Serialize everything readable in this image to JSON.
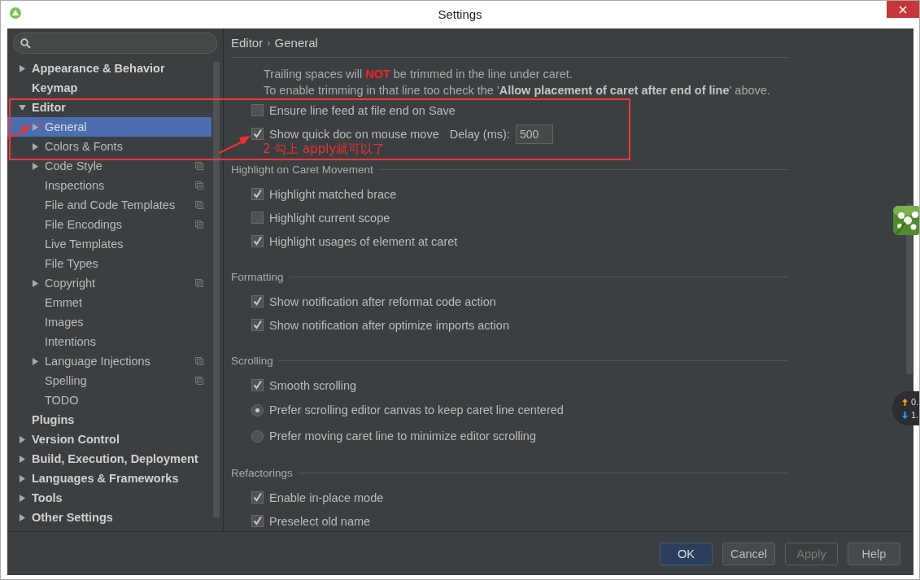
{
  "window": {
    "title": "Settings"
  },
  "sidebar": {
    "items": [
      {
        "label": "Appearance & Behavior",
        "expanded": false,
        "selected": false,
        "per_project": false
      },
      {
        "label": "Keymap",
        "selected": false,
        "per_project": false
      },
      {
        "label": "Editor",
        "expanded": true,
        "selected": false,
        "per_project": false,
        "children": [
          {
            "label": "General",
            "expanded": false,
            "selected": true,
            "per_project": false
          },
          {
            "label": "Colors & Fonts",
            "expanded": false,
            "selected": false,
            "per_project": false
          },
          {
            "label": "Code Style",
            "expanded": false,
            "selected": false,
            "per_project": true
          },
          {
            "label": "Inspections",
            "selected": false,
            "per_project": true
          },
          {
            "label": "File and Code Templates",
            "selected": false,
            "per_project": true
          },
          {
            "label": "File Encodings",
            "selected": false,
            "per_project": true
          },
          {
            "label": "Live Templates",
            "selected": false,
            "per_project": false
          },
          {
            "label": "File Types",
            "selected": false,
            "per_project": false
          },
          {
            "label": "Copyright",
            "expanded": false,
            "selected": false,
            "per_project": true
          },
          {
            "label": "Emmet",
            "selected": false,
            "per_project": false
          },
          {
            "label": "Images",
            "selected": false,
            "per_project": false
          },
          {
            "label": "Intentions",
            "selected": false,
            "per_project": false
          },
          {
            "label": "Language Injections",
            "expanded": false,
            "selected": false,
            "per_project": true
          },
          {
            "label": "Spelling",
            "selected": false,
            "per_project": true
          },
          {
            "label": "TODO",
            "selected": false,
            "per_project": false
          }
        ]
      },
      {
        "label": "Plugins",
        "selected": false,
        "per_project": false
      },
      {
        "label": "Version Control",
        "expanded": false,
        "selected": false,
        "per_project": false
      },
      {
        "label": "Build, Execution, Deployment",
        "expanded": false,
        "selected": false,
        "per_project": false
      },
      {
        "label": "Languages & Frameworks",
        "expanded": false,
        "selected": false,
        "per_project": false
      },
      {
        "label": "Tools",
        "expanded": false,
        "selected": false,
        "per_project": false
      },
      {
        "label": "Other Settings",
        "expanded": false,
        "selected": false,
        "per_project": false
      }
    ]
  },
  "breadcrumb": [
    "Editor",
    "›",
    "General"
  ],
  "notes": [
    {
      "parts": [
        {
          "kind": "plain",
          "text": "Trailing spaces will "
        },
        {
          "kind": "warning",
          "text": "NOT"
        },
        {
          "kind": "plain",
          "text": " be trimmed in the line under caret."
        }
      ]
    },
    {
      "parts": [
        {
          "kind": "plain",
          "text": "To enable trimming in that line too check the '"
        },
        {
          "kind": "bold",
          "text": "Allow placement of caret after end of line"
        },
        {
          "kind": "plain",
          "text": "' above."
        }
      ]
    }
  ],
  "sections": [
    {
      "options": [
        {
          "kind": "checkbox",
          "label": "Ensure line feed at file end on Save",
          "checked": false
        },
        {
          "kind": "checkbox",
          "label": "Show quick doc on mouse move",
          "checked": true,
          "field_label": "Delay (ms):",
          "field_value": "500"
        }
      ]
    },
    {
      "title": "Highlight on Caret Movement",
      "options": [
        {
          "kind": "checkbox",
          "label": "Highlight matched brace",
          "checked": true
        },
        {
          "kind": "checkbox",
          "label": "Highlight current scope",
          "checked": false
        },
        {
          "kind": "checkbox",
          "label": "Highlight usages of element at caret",
          "checked": true
        }
      ]
    },
    {
      "title": "Formatting",
      "options": [
        {
          "kind": "checkbox",
          "label": "Show notification after reformat code action",
          "checked": true
        },
        {
          "kind": "checkbox",
          "label": "Show notification after optimize imports action",
          "checked": true
        }
      ]
    },
    {
      "title": "Scrolling",
      "options": [
        {
          "kind": "checkbox",
          "label": "Smooth scrolling",
          "checked": true
        },
        {
          "kind": "radio",
          "label": "Prefer scrolling editor canvas to keep caret line centered",
          "selected": true
        },
        {
          "kind": "radio",
          "label": "Prefer moving caret line to minimize editor scrolling",
          "selected": false
        }
      ]
    },
    {
      "title": "Refactorings",
      "options": [
        {
          "kind": "checkbox",
          "label": "Enable in-place mode",
          "checked": true
        },
        {
          "kind": "checkbox",
          "label": "Preselect old name",
          "checked": true
        }
      ]
    }
  ],
  "buttons": [
    {
      "label": "OK",
      "kind": "primary"
    },
    {
      "label": "Cancel",
      "kind": "normal"
    },
    {
      "label": "Apply",
      "kind": "disabled"
    },
    {
      "label": "Help",
      "kind": "normal"
    }
  ],
  "annotations": [
    {
      "text": "1"
    },
    {
      "text": "2 勾上 apply就可以了"
    }
  ],
  "speed_widget": {
    "up": "0.",
    "down": "1."
  }
}
